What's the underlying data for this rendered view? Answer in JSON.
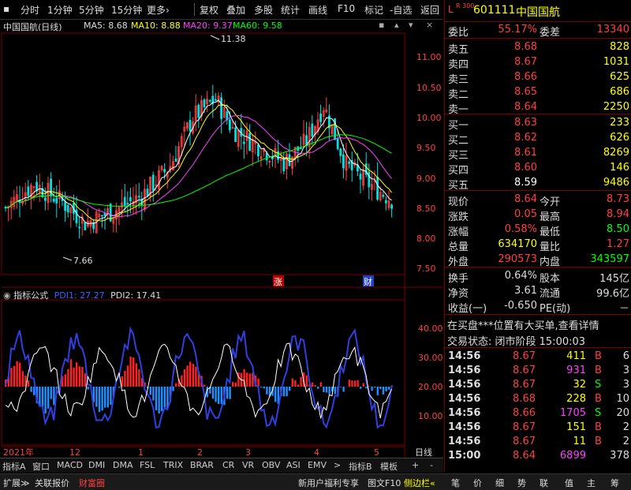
{
  "toolbar": {
    "items": [
      "分时",
      "1分钟",
      "5分钟",
      "15分钟",
      "更多›",
      "复权",
      "叠加",
      "多股",
      "统计",
      "画线",
      "F10",
      "标记",
      "-自选",
      "返回"
    ]
  },
  "chart_header": {
    "title": "中国国航(日线)",
    "ma5": "MA5: 8.68",
    "ma10": "MA10: 8.88",
    "ma20": "MA20: 9.37",
    "ma60": "MA60: 9.58"
  },
  "price_axis": [
    "11.00",
    "10.50",
    "10.00",
    "9.50",
    "9.00",
    "8.50",
    "8.00",
    "7.50"
  ],
  "price_annotations": {
    "high": "11.38",
    "low": "7.66"
  },
  "markers": {
    "zhang": "涨",
    "cai": "财"
  },
  "indicator_header": {
    "name": "指标公式",
    "pdi1": "PDI1: 27.27",
    "pdi2": "PDI2: 17.41"
  },
  "indicator_axis": [
    "40.00",
    "30.00",
    "20.00",
    "10.00"
  ],
  "time_axis": {
    "year": "2021年",
    "ticks": [
      "12",
      "1",
      "2",
      "3",
      "4",
      "5"
    ],
    "period": "日线"
  },
  "tabs": [
    "指标A",
    "窗口",
    "MACD",
    "DMI",
    "DMA",
    "FSL",
    "TRIX",
    "BRAR",
    "CR",
    "VR",
    "OBV",
    "ASI",
    "EMV",
    ">",
    "指标B",
    "模板",
    "+",
    "-"
  ],
  "status_bar": {
    "left": [
      "扩展≫",
      "关联报价",
      "财富圈"
    ],
    "mid": [
      "新用户福利专享",
      "图文F10",
      "侧边栏«"
    ],
    "right": [
      "笔",
      "价",
      "细",
      "势",
      "联",
      "值",
      "主",
      "筹"
    ]
  },
  "quote": {
    "badge": "L",
    "badge_sub": "R 300",
    "code": "601111",
    "name": "中国国航",
    "weibi_label": "委比",
    "weibi": "55.17%",
    "weicha_label": "委差",
    "weicha": "13340",
    "sell": [
      {
        "label": "卖五",
        "price": "8.68",
        "vol": "828"
      },
      {
        "label": "卖四",
        "price": "8.67",
        "vol": "1031"
      },
      {
        "label": "卖三",
        "price": "8.66",
        "vol": "625"
      },
      {
        "label": "卖二",
        "price": "8.65",
        "vol": "686"
      },
      {
        "label": "卖一",
        "price": "8.64",
        "vol": "2250"
      }
    ],
    "buy": [
      {
        "label": "买一",
        "price": "8.63",
        "vol": "233"
      },
      {
        "label": "买二",
        "price": "8.62",
        "vol": "626"
      },
      {
        "label": "买三",
        "price": "8.61",
        "vol": "8269"
      },
      {
        "label": "买四",
        "price": "8.60",
        "vol": "146"
      },
      {
        "label": "买五",
        "price": "8.59",
        "vol": "9486"
      }
    ],
    "stats": [
      {
        "l1": "现价",
        "v1": "8.64",
        "l2": "今开",
        "v2": "8.73"
      },
      {
        "l1": "涨跌",
        "v1": "0.05",
        "l2": "最高",
        "v2": "8.94"
      },
      {
        "l1": "涨幅",
        "v1": "0.58%",
        "l2": "最低",
        "v2": "8.50"
      },
      {
        "l1": "总量",
        "v1": "634170",
        "l2": "量比",
        "v2": "1.27"
      },
      {
        "l1": "外盘",
        "v1": "290573",
        "l2": "内盘",
        "v2": "343597"
      }
    ],
    "fund": [
      {
        "l1": "换手",
        "v1": "0.64%",
        "l2": "股本",
        "v2": "145亿"
      },
      {
        "l1": "净资",
        "v1": "3.61",
        "l2": "流通",
        "v2": "99.6亿"
      },
      {
        "l1": "收益(一)",
        "v1": "-0.650",
        "l2": "PE(动)",
        "v2": "－"
      }
    ],
    "notice": "在买盘***位置有大买单,查看详情",
    "trade_state": "交易状态: 闭市阶段 15:00:03",
    "ticks": [
      {
        "t": "14:56",
        "p": "8.67",
        "v": "411",
        "s": "B",
        "n": "6"
      },
      {
        "t": "14:56",
        "p": "8.67",
        "v": "931",
        "s": "B",
        "n": "3"
      },
      {
        "t": "14:56",
        "p": "8.67",
        "v": "32",
        "s": "S",
        "n": "3"
      },
      {
        "t": "14:56",
        "p": "8.68",
        "v": "228",
        "s": "B",
        "n": "10"
      },
      {
        "t": "14:56",
        "p": "8.66",
        "v": "1705",
        "s": "S",
        "n": "20"
      },
      {
        "t": "14:56",
        "p": "8.67",
        "v": "151",
        "s": "B",
        "n": "2"
      },
      {
        "t": "14:56",
        "p": "8.67",
        "v": "11",
        "s": "B",
        "n": "2"
      },
      {
        "t": "15:00",
        "p": "8.64",
        "v": "6899",
        "s": "",
        "n": "378"
      }
    ]
  },
  "colors": {
    "up": "#ff4040",
    "down": "#00e0e0",
    "ma5": "#ffffff",
    "ma10": "#ffff00",
    "ma20": "#ff40ff",
    "ma60": "#00ff00",
    "frame": "#7a0000"
  }
}
